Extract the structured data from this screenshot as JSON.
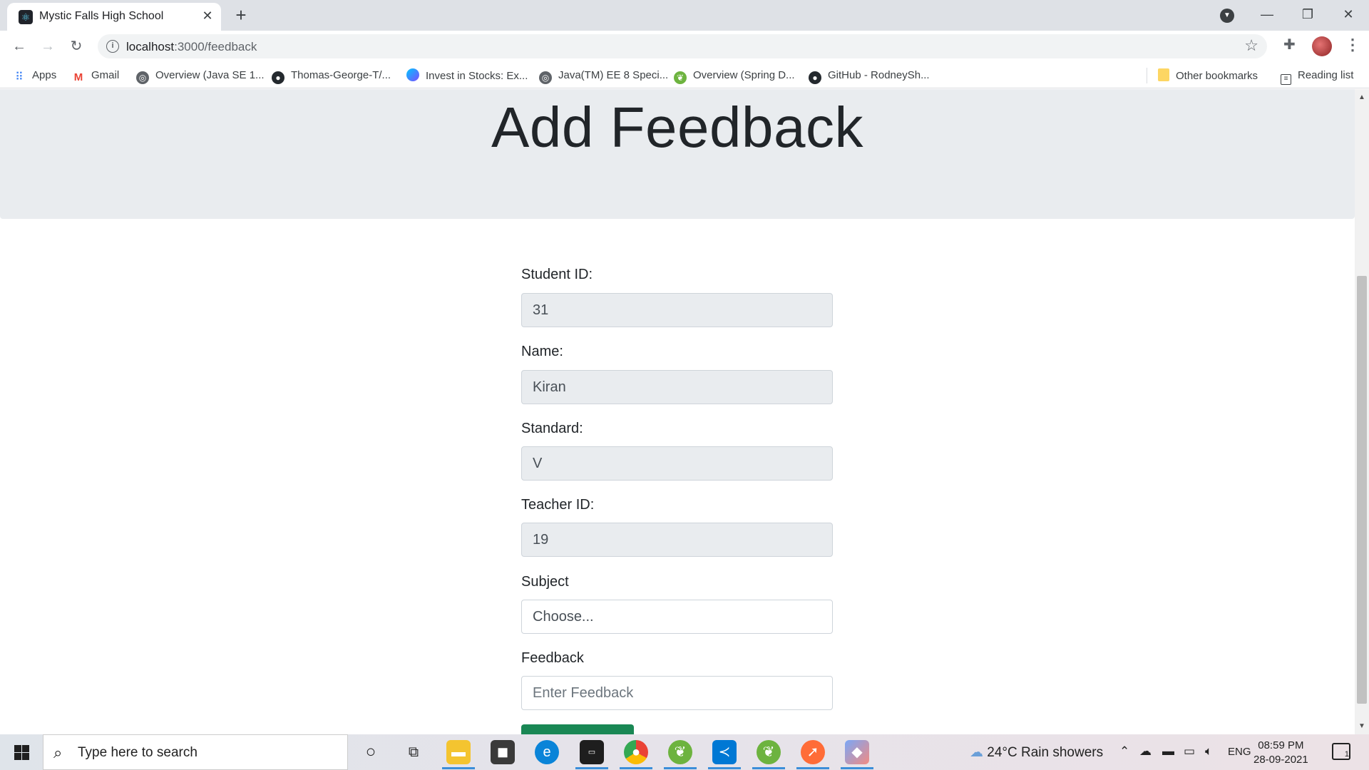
{
  "browser": {
    "tab_title": "Mystic Falls High School",
    "url_host": "localhost",
    "url_path": ":3000/feedback",
    "bookmarks": [
      {
        "label": "Apps",
        "icon": "apps-grid-icon",
        "color": "#4285f4"
      },
      {
        "label": "Gmail",
        "icon": "gmail-icon",
        "color": "#ea4335"
      },
      {
        "label": "Overview (Java SE 1...",
        "icon": "globe-icon",
        "color": "#5f6368"
      },
      {
        "label": "Thomas-George-T/...",
        "icon": "github-icon",
        "color": "#24292e"
      },
      {
        "label": "Invest in Stocks: Ex...",
        "icon": "invest-icon",
        "color": "#7c4dff"
      },
      {
        "label": "Java(TM) EE 8 Speci...",
        "icon": "globe-icon",
        "color": "#5f6368"
      },
      {
        "label": "Overview (Spring D...",
        "icon": "spring-icon",
        "color": "#6db33f"
      },
      {
        "label": "GitHub - RodneySh...",
        "icon": "github-icon",
        "color": "#24292e"
      }
    ],
    "other_bookmarks": "Other bookmarks",
    "reading_list": "Reading list"
  },
  "page": {
    "heading": "Add Feedback",
    "fields": [
      {
        "label": "Student ID:",
        "value": "31",
        "readonly": true
      },
      {
        "label": "Name:",
        "value": "Kiran",
        "readonly": true
      },
      {
        "label": "Standard:",
        "value": "V",
        "readonly": true
      },
      {
        "label": "Teacher ID:",
        "value": "19",
        "readonly": true
      }
    ],
    "subject": {
      "label": "Subject",
      "selected": "Choose..."
    },
    "feedback": {
      "label": "Feedback",
      "placeholder": "Enter Feedback"
    },
    "submit_color": "#198754"
  },
  "taskbar": {
    "search_placeholder": "Type here to search",
    "weather": "24°C  Rain showers",
    "language": "ENG",
    "time": "08:59 PM",
    "date": "28-09-2021",
    "notification_count": "1"
  }
}
